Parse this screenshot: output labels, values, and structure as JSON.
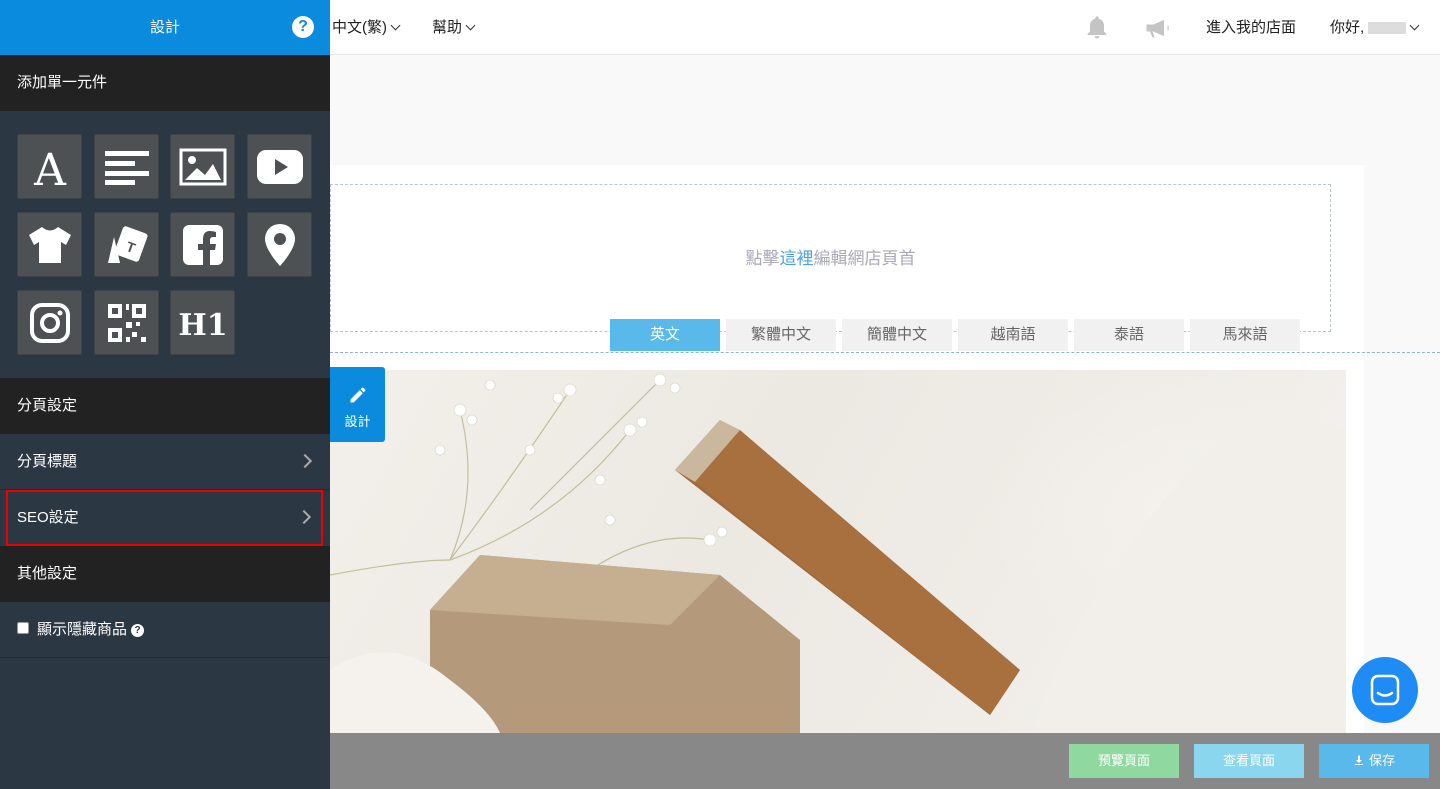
{
  "sidebar": {
    "header_title": "設計",
    "help_symbol": "?",
    "add_section": "添加單一元件",
    "widgets": [
      {
        "name": "text-widget-icon"
      },
      {
        "name": "paragraph-widget-icon"
      },
      {
        "name": "image-widget-icon"
      },
      {
        "name": "youtube-widget-icon"
      },
      {
        "name": "product-widget-icon"
      },
      {
        "name": "category-widget-icon"
      },
      {
        "name": "facebook-widget-icon"
      },
      {
        "name": "map-pin-widget-icon"
      },
      {
        "name": "instagram-widget-icon"
      },
      {
        "name": "qr-code-widget-icon"
      },
      {
        "name": "heading-widget-icon",
        "label": "H1"
      }
    ],
    "page_settings_section": "分頁設定",
    "page_title_item": "分頁標題",
    "seo_item": "SEO設定",
    "other_settings_section": "其他設定",
    "show_hidden_label": "顯示隱藏商品"
  },
  "topbar": {
    "language": "中文(繁)",
    "help": "幫助",
    "enter_store": "進入我的店面",
    "greeting": "你好,"
  },
  "canvas": {
    "header_prefix": "點擊",
    "header_link": "這裡",
    "header_suffix": "編輯網店頁首",
    "lang_tabs": [
      "英文",
      "繁體中文",
      "簡體中文",
      "越南語",
      "泰語",
      "馬來語"
    ],
    "design_button": "設計"
  },
  "bottom": {
    "preview": "預覽頁面",
    "view": "查看頁面",
    "save": "保存"
  },
  "colors": {
    "accent": "#0b8bdd",
    "preview_btn": "#8fd8a0",
    "view_btn": "#8ad6ee",
    "save_btn": "#59b9ea"
  }
}
